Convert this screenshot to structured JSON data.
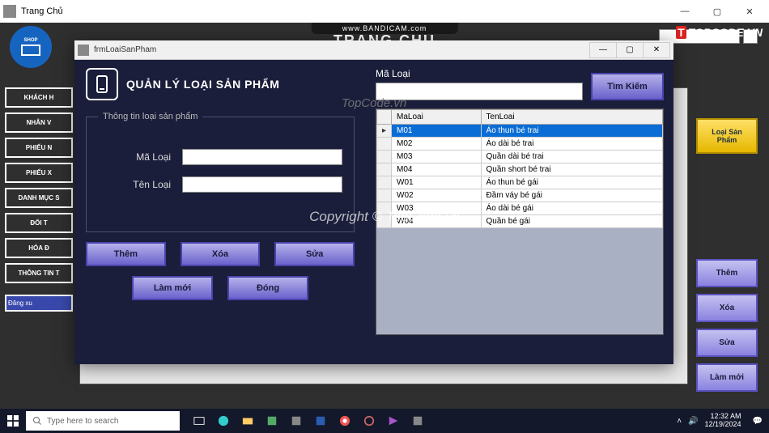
{
  "main_window": {
    "title": "Trang Chủ",
    "app_title": "TRANG CHỦ",
    "shop_label": "SHOP"
  },
  "bandicam": "www.BANDICAM.com",
  "topcode": {
    "red": "T",
    "rest": "TOPCODE.VN"
  },
  "sidebar": {
    "items": [
      {
        "label": "KHÁCH H"
      },
      {
        "label": "NHÂN V"
      },
      {
        "label": "PHIẾU N"
      },
      {
        "label": "PHIẾU X"
      },
      {
        "label": "DANH MỤC S"
      },
      {
        "label": "ĐỔI T"
      },
      {
        "label": "HÓA Đ"
      },
      {
        "label": "THÔNG TIN T"
      }
    ],
    "logout": "Đăng xu"
  },
  "right_panel": {
    "highlight": "Loại Sản Phẩm",
    "buttons": [
      {
        "label": "Thêm"
      },
      {
        "label": "Xóa"
      },
      {
        "label": "Sửa"
      },
      {
        "label": "Làm mới"
      }
    ]
  },
  "dialog": {
    "title": "frmLoaiSanPham",
    "heading": "QUẢN LÝ LOẠI SẢN PHẨM",
    "group_legend": "Thông tin loại sản phẩm",
    "fields": {
      "ma_loai_label": "Mã Loại",
      "ma_loai_value": "",
      "ten_loai_label": "Tên Loại",
      "ten_loai_value": ""
    },
    "buttons": {
      "them": "Thêm",
      "xoa": "Xóa",
      "sua": "Sửa",
      "lammoi": "Làm mới",
      "dong": "Đóng"
    },
    "search": {
      "label": "Mã Loại",
      "value": "",
      "button": "Tìm Kiếm"
    },
    "grid": {
      "columns": [
        "MaLoai",
        "TenLoai"
      ],
      "rows": [
        {
          "MaLoai": "M01",
          "TenLoai": "Áo thun bé trai",
          "selected": true
        },
        {
          "MaLoai": "M02",
          "TenLoai": "Áo dài bé trai"
        },
        {
          "MaLoai": "M03",
          "TenLoai": "Quần dài bé trai"
        },
        {
          "MaLoai": "M04",
          "TenLoai": "Quần short bé trai"
        },
        {
          "MaLoai": "W01",
          "TenLoai": "Áo thun bé gái"
        },
        {
          "MaLoai": "W02",
          "TenLoai": "Đầm váy bé gái"
        },
        {
          "MaLoai": "W03",
          "TenLoai": "Áo dài bé gái"
        },
        {
          "MaLoai": "W04",
          "TenLoai": "Quần bé gái"
        }
      ]
    }
  },
  "watermarks": {
    "center": "Copyright © TopCode.vn",
    "dialog": "TopCode.vn"
  },
  "taskbar": {
    "search_placeholder": "Type here to search",
    "time": "12:32 AM",
    "date": "12/19/2024"
  }
}
